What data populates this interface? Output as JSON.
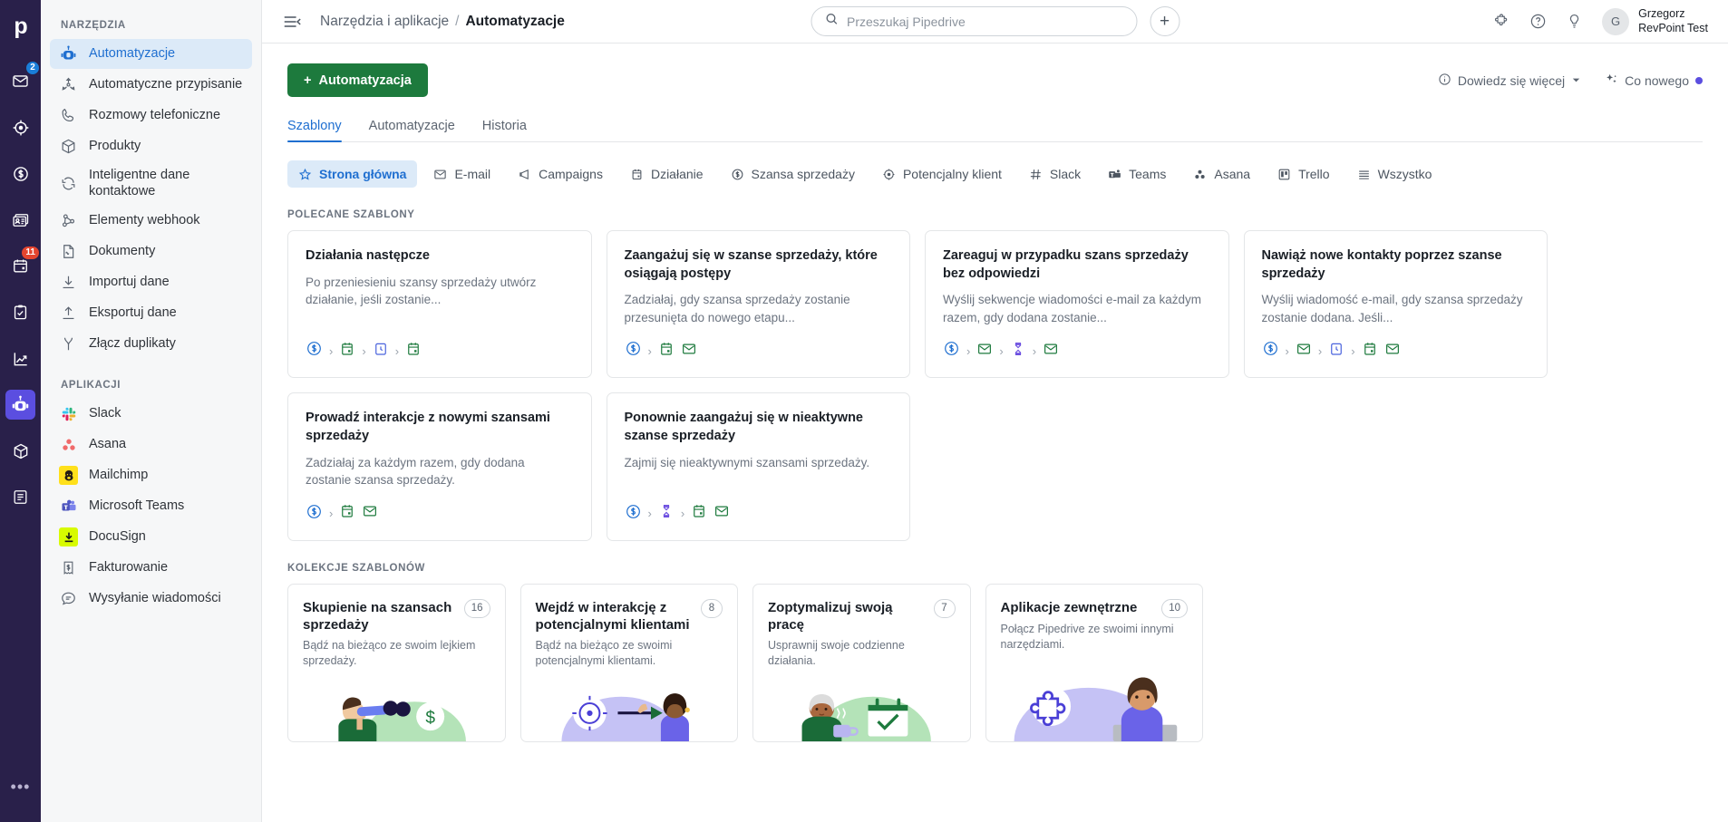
{
  "brand": {
    "logo_letter": "p",
    "accent_green": "#1d7a3d",
    "accent_blue": "#1f6fd0",
    "purple": "#5b4ee0",
    "rail_bg": "#29204a"
  },
  "rail": {
    "items": [
      {
        "name": "mail-icon",
        "badge": "2",
        "badge_color": "#1a7ed8"
      },
      {
        "name": "leads-icon",
        "badge": ""
      },
      {
        "name": "deals-icon",
        "badge": ""
      },
      {
        "name": "contacts-icon",
        "badge": ""
      },
      {
        "name": "calendar-icon",
        "badge": "11",
        "badge_color": "#e5452f"
      },
      {
        "name": "activities-icon",
        "badge": ""
      },
      {
        "name": "insights-icon",
        "badge": ""
      },
      {
        "name": "automations-icon",
        "badge": "",
        "active": true
      },
      {
        "name": "products-icon",
        "badge": ""
      },
      {
        "name": "campaigns-icon",
        "badge": ""
      }
    ],
    "more_label": "•••"
  },
  "topbar": {
    "hamburger": "menu-collapse-icon",
    "breadcrumb_parent": "Narzędzia i aplikacje",
    "breadcrumb_sep": "/",
    "breadcrumb_current": "Automatyzacje",
    "search_placeholder": "Przeszukaj Pipedrive",
    "search_value": "",
    "add_label": "+",
    "icons": [
      "puzzle-icon",
      "help-icon",
      "lightbulb-icon"
    ],
    "user": {
      "initial": "G",
      "name": "Grzegorz",
      "org": "RevPoint Test"
    }
  },
  "actions": {
    "primary_label": "Automatyzacja",
    "primary_plus": "+",
    "learn_more": "Dowiedz się więcej",
    "whats_new": "Co nowego"
  },
  "tabs": [
    {
      "label": "Szablony",
      "active": true
    },
    {
      "label": "Automatyzacje",
      "active": false
    },
    {
      "label": "Historia",
      "active": false
    }
  ],
  "chips": [
    {
      "label": "Strona główna",
      "icon": "star-icon",
      "active": true
    },
    {
      "label": "E-mail",
      "icon": "email-icon",
      "active": false
    },
    {
      "label": "Campaigns",
      "icon": "megaphone-icon",
      "active": false
    },
    {
      "label": "Działanie",
      "icon": "calendar-icon",
      "active": false
    },
    {
      "label": "Szansa sprzedaży",
      "icon": "deal-icon",
      "active": false
    },
    {
      "label": "Potencjalny klient",
      "icon": "lead-icon",
      "active": false
    },
    {
      "label": "Slack",
      "icon": "slack-icon",
      "active": false
    },
    {
      "label": "Teams",
      "icon": "teams-icon",
      "active": false
    },
    {
      "label": "Asana",
      "icon": "asana-icon",
      "active": false
    },
    {
      "label": "Trello",
      "icon": "trello-icon",
      "active": false
    },
    {
      "label": "Wszystko",
      "icon": "list-icon",
      "active": false
    }
  ],
  "sidebar": {
    "tools_title": "NARZĘDZIA",
    "tools": [
      {
        "label": "Automatyzacje",
        "icon": "robot-icon",
        "active": true
      },
      {
        "label": "Automatyczne przypisanie",
        "icon": "assign-icon",
        "active": false
      },
      {
        "label": "Rozmowy telefoniczne",
        "icon": "phone-icon",
        "active": false
      },
      {
        "label": "Produkty",
        "icon": "box-icon",
        "active": false
      },
      {
        "label": "Inteligentne dane kontaktowe",
        "icon": "sync-icon",
        "active": false
      },
      {
        "label": "Elementy webhook",
        "icon": "webhook-icon",
        "active": false
      },
      {
        "label": "Dokumenty",
        "icon": "document-icon",
        "active": false
      },
      {
        "label": "Importuj dane",
        "icon": "import-icon",
        "active": false
      },
      {
        "label": "Eksportuj dane",
        "icon": "export-icon",
        "active": false
      },
      {
        "label": "Złącz duplikaty",
        "icon": "merge-icon",
        "active": false
      }
    ],
    "apps_title": "APLIKACJI",
    "apps": [
      {
        "label": "Slack",
        "icon": "slack-logo"
      },
      {
        "label": "Asana",
        "icon": "asana-logo"
      },
      {
        "label": "Mailchimp",
        "icon": "mailchimp-logo"
      },
      {
        "label": "Microsoft Teams",
        "icon": "teams-logo"
      },
      {
        "label": "DocuSign",
        "icon": "docusign-logo"
      },
      {
        "label": "Fakturowanie",
        "icon": "invoice-icon"
      },
      {
        "label": "Wysyłanie wiadomości",
        "icon": "messaging-icon"
      }
    ]
  },
  "recommended": {
    "section_title": "POLECANE SZABLONY",
    "cards": [
      {
        "title": "Działania następcze",
        "desc": "Po przeniesieniu szansy sprzedaży utwórz działanie, jeśli zostanie...",
        "flow": [
          "deal",
          "activity",
          "delay",
          "activity"
        ]
      },
      {
        "title": "Zaangażuj się w szanse sprzedaży, które osiągają postępy",
        "desc": "Zadziałaj, gdy szansa sprzedaży zostanie przesunięta do nowego etapu...",
        "flow": [
          "deal",
          "activity",
          "email-nogap"
        ]
      },
      {
        "title": "Zareaguj w przypadku szans sprzedaży bez odpowiedzi",
        "desc": "Wyślij sekwencje wiadomości e-mail za każdym razem, gdy dodana zostanie...",
        "flow": [
          "deal",
          "email",
          "hourglass",
          "email"
        ]
      },
      {
        "title": "Nawiąż nowe kontakty poprzez szanse sprzedaży",
        "desc": "Wyślij wiadomość e-mail, gdy szansa sprzedaży zostanie dodana. Jeśli...",
        "flow": [
          "deal",
          "email",
          "delay",
          "activity",
          "email-nogap"
        ]
      },
      {
        "title": "Prowadź interakcje z nowymi szansami sprzedaży",
        "desc": "Zadziałaj za każdym razem, gdy dodana zostanie szansa sprzedaży.",
        "flow": [
          "deal",
          "activity",
          "email-nogap"
        ]
      },
      {
        "title": "Ponownie zaangażuj się w nieaktywne szanse sprzedaży",
        "desc": "Zajmij się nieaktywnymi szansami sprzedaży.",
        "flow": [
          "deal",
          "hourglass",
          "activity",
          "email-nogap"
        ]
      }
    ]
  },
  "collections": {
    "section_title": "KOLEKCJE SZABLONÓW",
    "cards": [
      {
        "title": "Skupienie na szansach sprzedaży",
        "count": "16",
        "desc": "Bądź na bieżąco ze swoim lejkiem sprzedaży.",
        "art": "binoculars-art",
        "art_bg": "#b4e3b8"
      },
      {
        "title": "Wejdź w interakcję z potencjalnymi klientami",
        "count": "8",
        "desc": "Bądź na bieżąco ze swoimi potencjalnymi klientami.",
        "art": "target-art",
        "art_bg": "#c5c2f5"
      },
      {
        "title": "Zoptymalizuj swoją pracę",
        "count": "7",
        "desc": "Usprawnij swoje codzienne działania.",
        "art": "coffee-art",
        "art_bg": "#b4e3b8"
      },
      {
        "title": "Aplikacje zewnętrzne",
        "count": "10",
        "desc": "Połącz Pipedrive ze swoimi innymi narzędziami.",
        "art": "puzzle-art",
        "art_bg": "#c5c2f5"
      }
    ]
  }
}
